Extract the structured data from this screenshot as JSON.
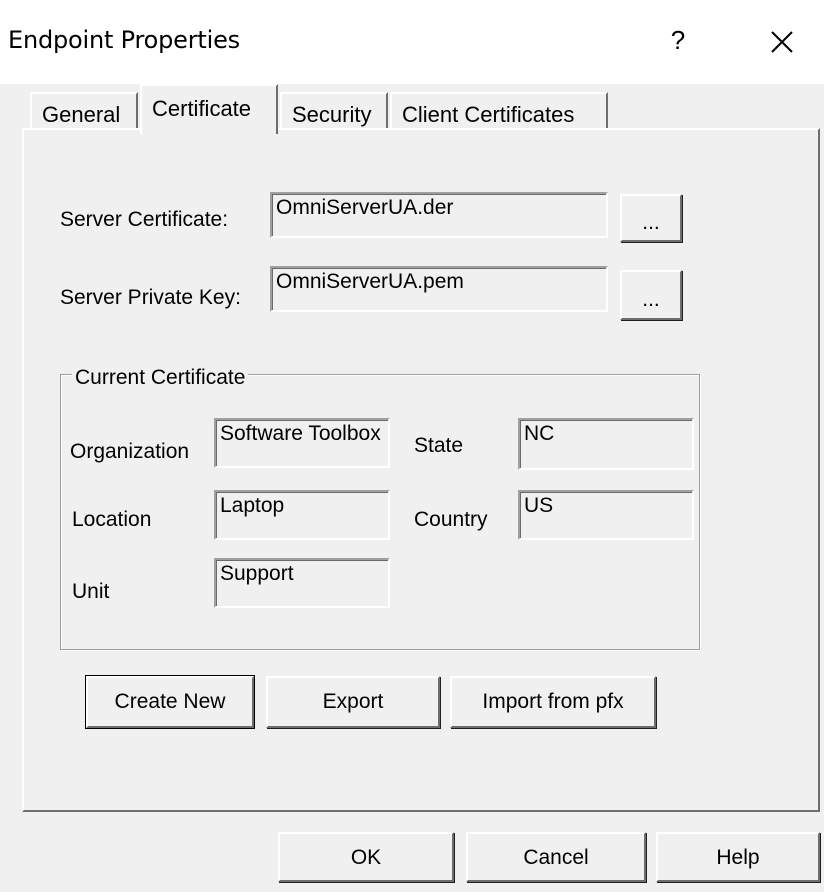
{
  "window": {
    "title": "Endpoint Properties",
    "help_label": "?",
    "close_icon": "close-icon"
  },
  "tabs": [
    {
      "label": "General",
      "active": false
    },
    {
      "label": "Certificate",
      "active": true
    },
    {
      "label": "Security",
      "active": false
    },
    {
      "label": "Client Certificates",
      "active": false
    }
  ],
  "certificate": {
    "server_certificate_label": "Server Certificate:",
    "server_certificate_value": "OmniServerUA.der",
    "server_private_key_label": "Server Private Key:",
    "server_private_key_value": "OmniServerUA.pem",
    "browse_label": "..."
  },
  "current_certificate": {
    "group_title": "Current Certificate",
    "organization_label": "Organization",
    "organization_value": "Software Toolbox",
    "state_label": "State",
    "state_value": "NC",
    "location_label": "Location",
    "location_value": "Laptop",
    "country_label": "Country",
    "country_value": "US",
    "unit_label": "Unit",
    "unit_value": "Support"
  },
  "actions": {
    "create_new": "Create New",
    "export": "Export",
    "import_pfx": "Import from pfx"
  },
  "dialog_buttons": {
    "ok": "OK",
    "cancel": "Cancel",
    "help": "Help"
  },
  "colors": {
    "dialog_face": "#f0f0f0",
    "title_bar": "#ffffff"
  }
}
